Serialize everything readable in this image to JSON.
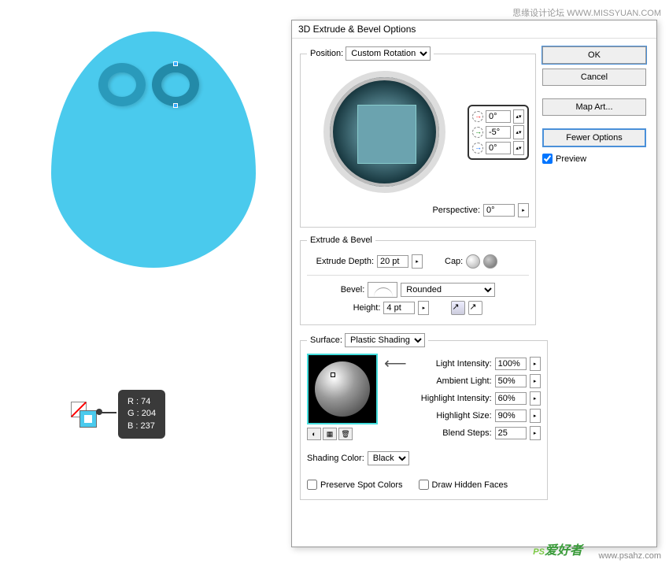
{
  "watermark": {
    "top": "思缘设计论坛  WWW.MISSYUAN.COM",
    "bottom_url": "www.psahz.com",
    "logo_prefix": "PS",
    "logo_suffix": "爱好者"
  },
  "rgb": {
    "r_label": "R :",
    "r": "74",
    "g_label": "G :",
    "g": "204",
    "b_label": "B :",
    "b": "237"
  },
  "dialog": {
    "title": "3D Extrude & Bevel Options",
    "buttons": {
      "ok": "OK",
      "cancel": "Cancel",
      "map_art": "Map Art...",
      "fewer_options": "Fewer Options"
    },
    "preview_label": "Preview",
    "position": {
      "legend": "Position:",
      "dropdown": "Custom Rotation",
      "x": "0°",
      "y": "-5°",
      "z": "0°",
      "perspective_label": "Perspective:",
      "perspective": "0°"
    },
    "extrude": {
      "legend": "Extrude & Bevel",
      "depth_label": "Extrude Depth:",
      "depth": "20 pt",
      "cap_label": "Cap:",
      "bevel_label": "Bevel:",
      "bevel": "Rounded",
      "height_label": "Height:",
      "height": "4 pt"
    },
    "surface": {
      "legend": "Surface:",
      "dropdown": "Plastic Shading",
      "light_intensity_label": "Light Intensity:",
      "light_intensity": "100%",
      "ambient_label": "Ambient Light:",
      "ambient": "50%",
      "highlight_intensity_label": "Highlight Intensity:",
      "highlight_intensity": "60%",
      "highlight_size_label": "Highlight Size:",
      "highlight_size": "90%",
      "blend_steps_label": "Blend Steps:",
      "blend_steps": "25",
      "shading_color_label": "Shading Color:",
      "shading_color": "Black",
      "preserve_spot": "Preserve Spot Colors",
      "draw_hidden": "Draw Hidden Faces"
    }
  }
}
